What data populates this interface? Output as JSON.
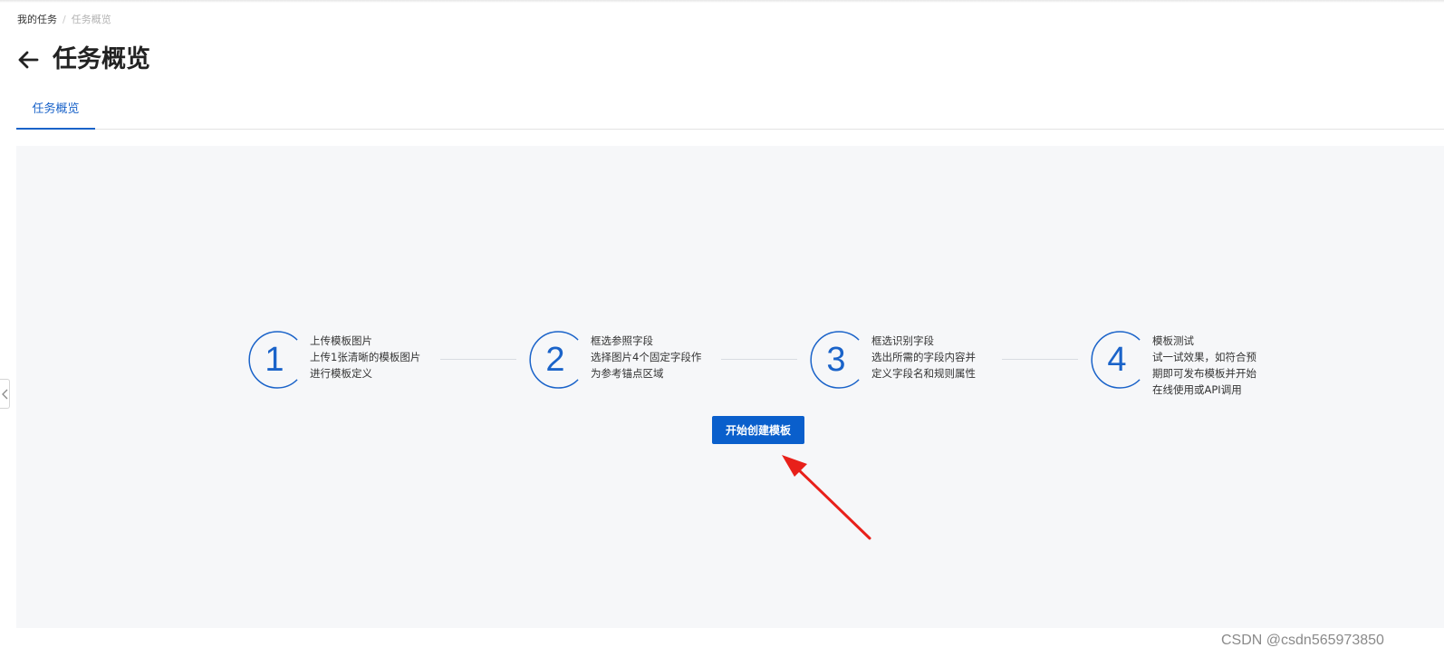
{
  "breadcrumb": {
    "items": [
      "我的任务",
      "任务概览"
    ],
    "separator": "/"
  },
  "header": {
    "back_icon": "arrow-left-icon",
    "title": "任务概览"
  },
  "tabs": [
    {
      "label": "任务概览",
      "active": true
    }
  ],
  "steps": [
    {
      "number": "1",
      "title": "上传模板图片",
      "lines": [
        "上传1张清晰的模板图片",
        "进行模板定义"
      ]
    },
    {
      "number": "2",
      "title": "框选参照字段",
      "lines": [
        "选择图片4个固定字段作",
        "为参考锚点区域"
      ]
    },
    {
      "number": "3",
      "title": "框选识别字段",
      "lines": [
        "选出所需的字段内容并",
        "定义字段名和规则属性"
      ]
    },
    {
      "number": "4",
      "title": "模板测试",
      "lines": [
        "试一试效果，如符合预",
        "期即可发布模板并开始",
        "在线使用或API调用"
      ]
    }
  ],
  "actions": {
    "create_label": "开始创建模板"
  },
  "colors": {
    "accent": "#1a63c9",
    "button": "#0a5fcc",
    "panel_bg": "#f6f7f9",
    "annotation_arrow": "#e8201a"
  },
  "watermark": "CSDN @csdn565973850"
}
